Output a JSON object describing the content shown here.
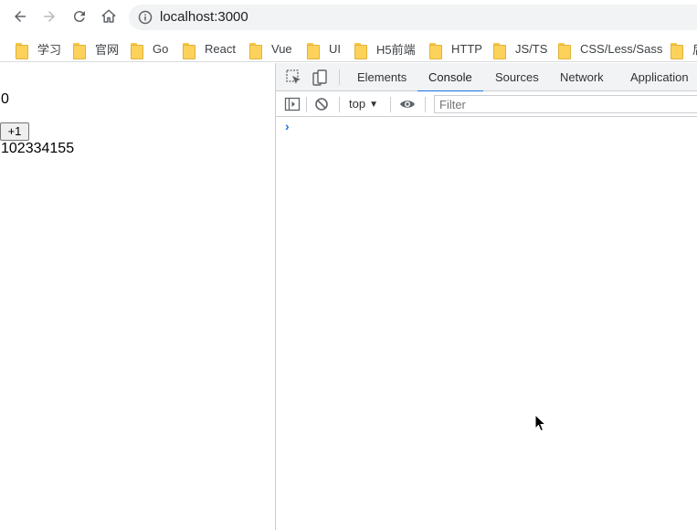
{
  "browser": {
    "url": "localhost:3000",
    "bookmarks": [
      {
        "label": "学习"
      },
      {
        "label": "官网"
      },
      {
        "label": "Go"
      },
      {
        "label": "React"
      },
      {
        "label": "Vue"
      },
      {
        "label": "UI"
      },
      {
        "label": "H5前端"
      },
      {
        "label": "HTTP"
      },
      {
        "label": "JS/TS"
      },
      {
        "label": "CSS/Less/Sass"
      },
      {
        "label": "后"
      }
    ]
  },
  "page": {
    "count": "0",
    "increment_label": "+1",
    "digits": "102334155"
  },
  "devtools": {
    "tabs": [
      {
        "label": "Elements"
      },
      {
        "label": "Console"
      },
      {
        "label": "Sources"
      },
      {
        "label": "Network"
      },
      {
        "label": "Application"
      }
    ],
    "active_tab": "Console",
    "context": "top",
    "filter_placeholder": "Filter",
    "prompt": "›"
  },
  "icons": {
    "back": "arrow-left-icon",
    "forward": "arrow-right-icon",
    "reload": "reload-icon",
    "home": "home-icon",
    "info": "info-icon",
    "inspect": "inspect-element-icon",
    "device": "device-toggle-icon",
    "sidebar": "sidebar-toggle-icon",
    "clear": "clear-console-icon",
    "eye": "eye-icon"
  },
  "colors": {
    "accent": "#1a73e8",
    "omnibox": "#f1f3f4",
    "folder": "#fcd25b"
  }
}
